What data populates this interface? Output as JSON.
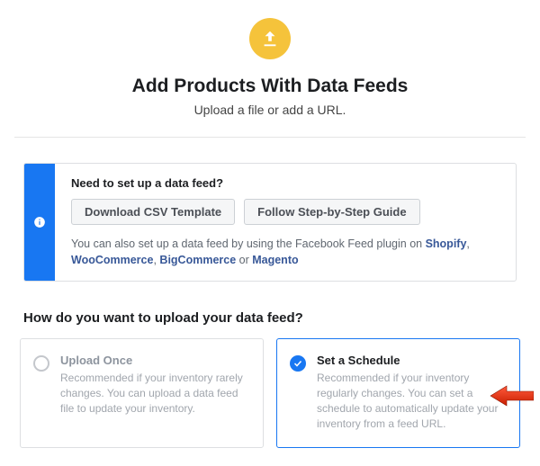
{
  "hero": {
    "title": "Add Products With Data Feeds",
    "subtitle": "Upload a file or add a URL."
  },
  "info": {
    "question": "Need to set up a data feed?",
    "btn_csv": "Download CSV Template",
    "btn_guide": "Follow Step-by-Step Guide",
    "help_prefix": "You can also set up a data feed by using the Facebook Feed plugin on ",
    "links": {
      "shopify": "Shopify",
      "woocommerce": "WooCommerce",
      "bigcommerce": "BigCommerce",
      "magento": "Magento"
    },
    "help_or": " or "
  },
  "upload_question": "How do you want to upload your data feed?",
  "options": {
    "upload_once": {
      "title": "Upload Once",
      "desc": "Recommended if your inventory rarely changes. You can upload a data feed file to update your inventory.",
      "selected": false
    },
    "set_schedule": {
      "title": "Set a Schedule",
      "desc": "Recommended if your inventory regularly changes. You can set a schedule to automatically update your inventory from a feed URL.",
      "selected": true
    }
  }
}
